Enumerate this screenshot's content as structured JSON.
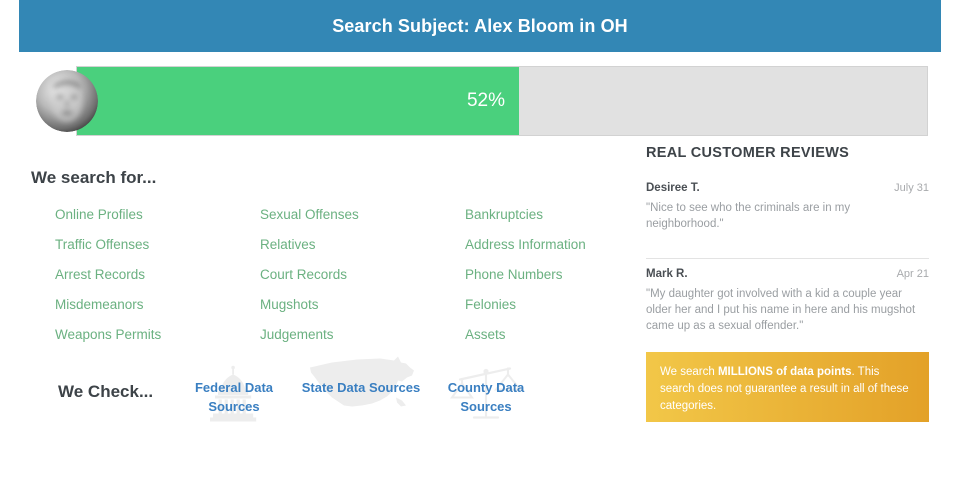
{
  "header": {
    "title": "Search Subject: Alex Bloom in OH",
    "background_color": "#3387b5"
  },
  "progress": {
    "percent_label": "52%",
    "percent_value": 52,
    "fill_color": "#4ad07d",
    "track_color": "#e1e1e1",
    "avatar_icon": "blurred-face-avatar"
  },
  "search_for": {
    "heading": "We search for...",
    "text_color": "#6bb181",
    "items": [
      "Online Profiles",
      "Sexual Offenses",
      "Bankruptcies",
      "Traffic Offenses",
      "Relatives",
      "Address Information",
      "Arrest Records",
      "Court Records",
      "Phone Numbers",
      "Misdemeanors",
      "Mugshots",
      "Felonies",
      "Weapons Permits",
      "Judgements",
      "Assets"
    ]
  },
  "we_check": {
    "heading": "We Check...",
    "link_color": "#3a7fc1",
    "sources": [
      {
        "label": "Federal Data Sources",
        "icon": "capitol-building-icon"
      },
      {
        "label": "State Data Sources",
        "icon": "usa-map-icon"
      },
      {
        "label": "County Data Sources",
        "icon": "scales-of-justice-icon"
      }
    ]
  },
  "reviews": {
    "heading": "REAL CUSTOMER REVIEWS",
    "items": [
      {
        "author": "Desiree T.",
        "date": "July 31",
        "text": "\"Nice to see who the criminals are in my neighborhood.\""
      },
      {
        "author": "Mark R.",
        "date": "Apr 21",
        "text": "\"My daughter got involved with a kid a couple year older her and I put his name in here and his mugshot came up as a sexual offender.\""
      }
    ]
  },
  "notice": {
    "lead": "We search ",
    "emphasis": "MILLIONS of data points",
    "rest": ". This search does not guarantee a result in all of these categories.",
    "background_start": "#f2c748",
    "background_end": "#e3a128"
  }
}
